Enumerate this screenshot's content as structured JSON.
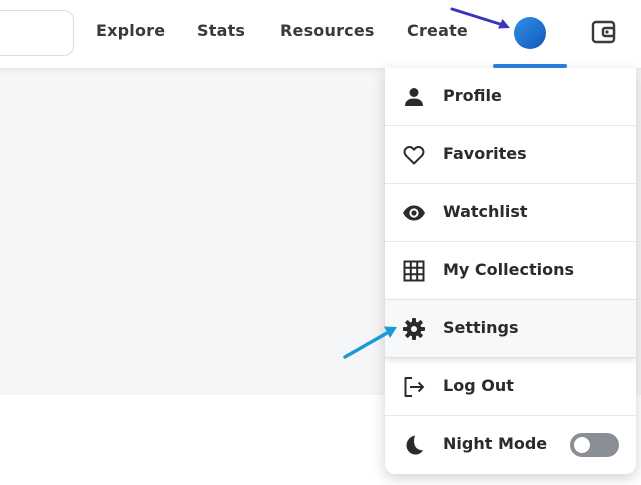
{
  "nav": {
    "links": [
      "Explore",
      "Stats",
      "Resources",
      "Create"
    ],
    "accent_color": "#2d80e0"
  },
  "menu": {
    "items": [
      {
        "label": "Profile",
        "icon": "person-icon"
      },
      {
        "label": "Favorites",
        "icon": "heart-icon"
      },
      {
        "label": "Watchlist",
        "icon": "eye-icon"
      },
      {
        "label": "My Collections",
        "icon": "grid-icon"
      },
      {
        "label": "Settings",
        "icon": "gear-icon"
      },
      {
        "label": "Log Out",
        "icon": "logout-icon"
      },
      {
        "label": "Night Mode",
        "icon": "moon-icon"
      }
    ],
    "night_mode_on": false
  },
  "annotations": {
    "arrow_colors": [
      "#3b35b8",
      "#1a9ad6"
    ]
  }
}
